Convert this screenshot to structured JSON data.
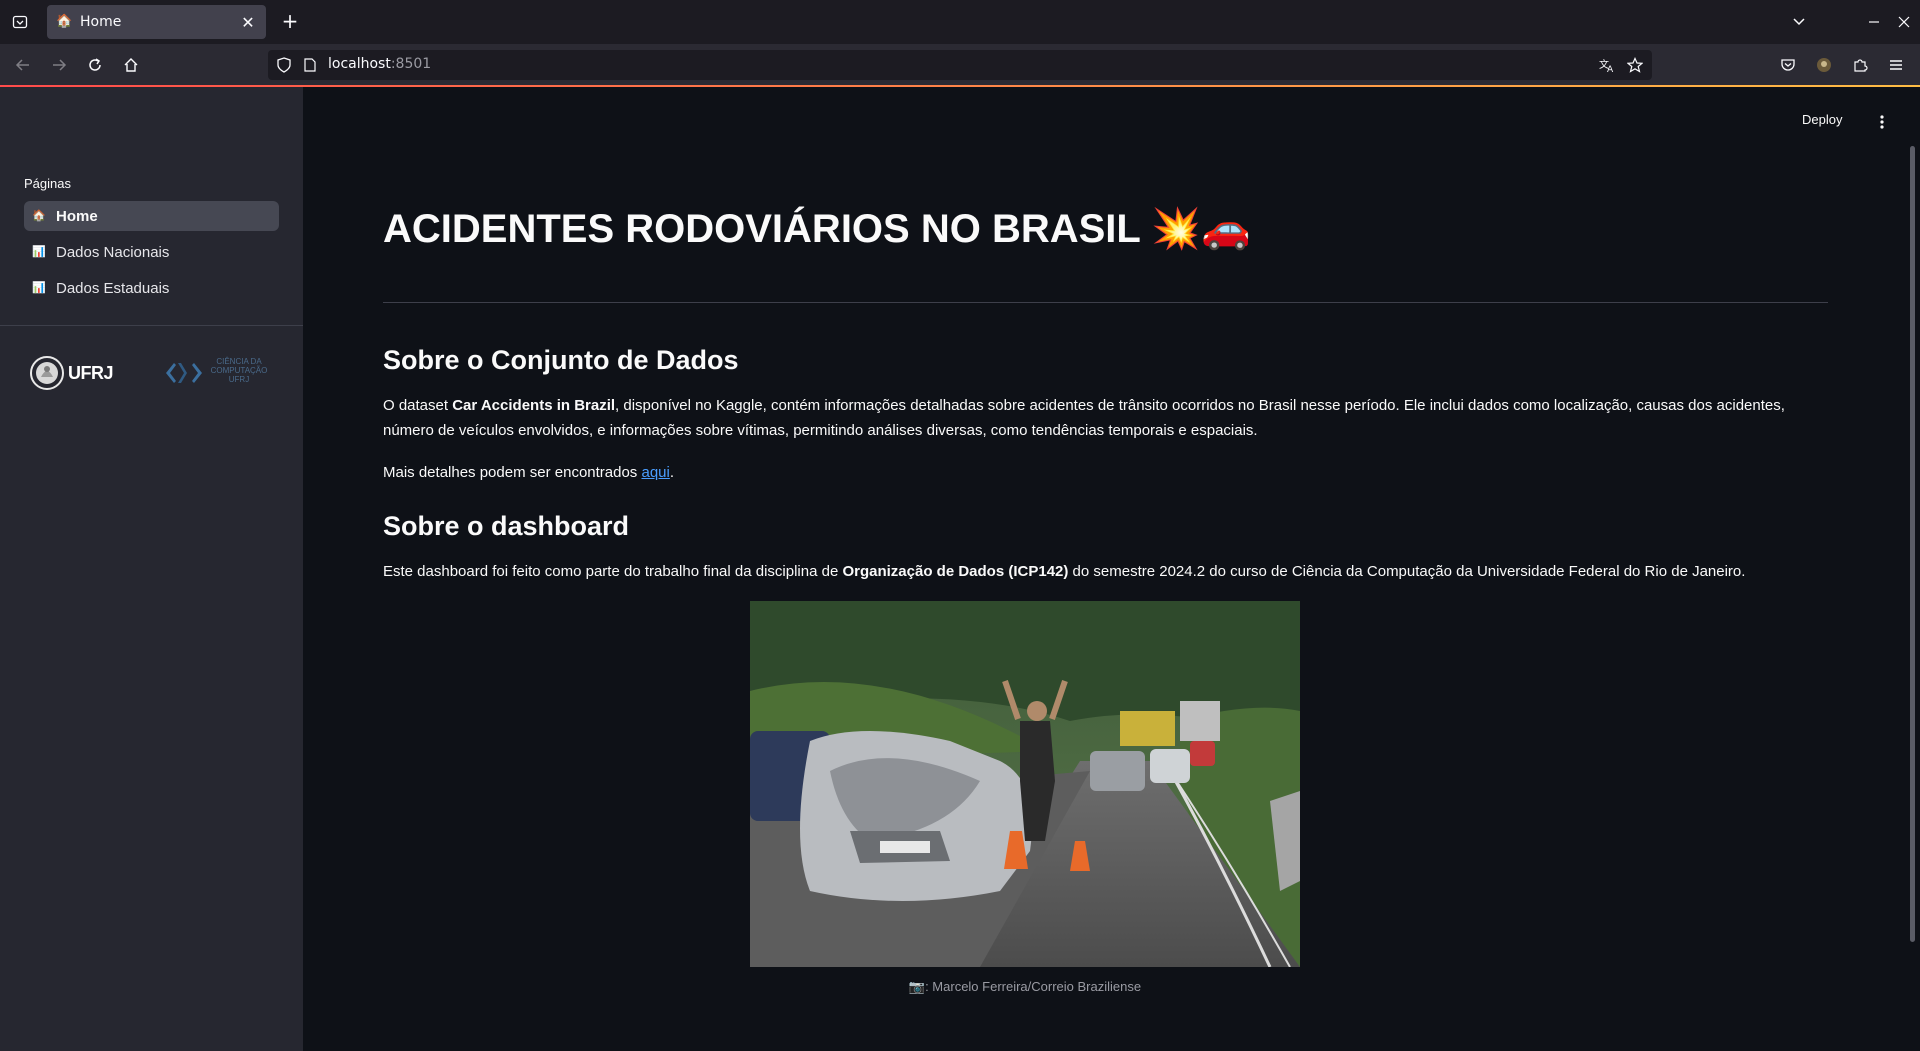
{
  "browser": {
    "tab_title": "Home",
    "tab_icon": "house-emoji-icon",
    "url_host": "localhost",
    "url_port": ":8501"
  },
  "sidebar": {
    "header": "Páginas",
    "items": [
      {
        "label": "Home",
        "icon": "house-icon",
        "active": true
      },
      {
        "label": "Dados Nacionais",
        "icon": "bar-chart-icon",
        "active": false
      },
      {
        "label": "Dados Estaduais",
        "icon": "bar-chart-icon",
        "active": false
      }
    ],
    "logos": {
      "ufrj": "UFRJ",
      "cc_line1": "CIÊNCIA DA",
      "cc_line2": "COMPUTAÇÃO",
      "cc_line3": "UFRJ"
    }
  },
  "header": {
    "deploy_label": "Deploy"
  },
  "main": {
    "title": "ACIDENTES RODOVIÁRIOS NO BRASIL",
    "title_emoji": "💥🚗",
    "section1": {
      "heading": "Sobre o Conjunto de Dados",
      "p1_before": "O dataset ",
      "p1_bold": "Car Accidents in Brazil",
      "p1_after": ", disponível no Kaggle, contém informações detalhadas sobre acidentes de trânsito ocorridos no Brasil nesse período. Ele inclui dados como localização, causas dos acidentes, número de veículos envolvidos, e informações sobre vítimas, permitindo análises diversas, como tendências temporais e espaciais.",
      "p2_before": "Mais detalhes podem ser encontrados ",
      "p2_link": "aqui",
      "p2_after": "."
    },
    "section2": {
      "heading": "Sobre o dashboard",
      "p_before": "Este dashboard foi feito como parte do trabalho final da disciplina de ",
      "p_bold": "Organização de Dados (ICP142)",
      "p_after": " do semestre 2024.2 do curso de Ciência da Computação da Universidade Federal do Rio de Janeiro."
    },
    "image_caption": "📷: Marcelo Ferreira/Correio Braziliense"
  }
}
